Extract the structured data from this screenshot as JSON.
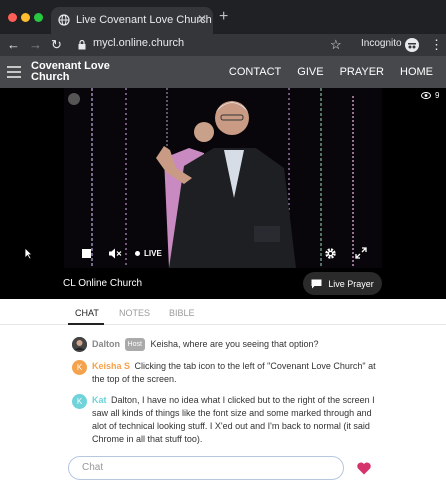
{
  "browser": {
    "tab_title": "Live Covenant Love Church",
    "tab_close": "✕",
    "new_tab": "+",
    "url": "mycl.online.church",
    "incognito": "Incognito",
    "back": "←",
    "forward": "→",
    "reload": "↻",
    "star": "☆",
    "menu": "⋮"
  },
  "site": {
    "brand": "Covenant Love Church",
    "nav": [
      "CONTACT",
      "GIVE",
      "PRAYER",
      "HOME"
    ]
  },
  "video": {
    "live_label": "LIVE",
    "viewer_count": "9",
    "channel": "CL Online Church",
    "live_prayer_button": "Live Prayer"
  },
  "chat": {
    "tabs": [
      "CHAT",
      "NOTES",
      "BIBLE"
    ],
    "active_tab": "CHAT",
    "messages": [
      {
        "name": "Dalton",
        "badge": "Host",
        "text": "Keisha, where are you seeing that option?",
        "avatar_color": "#3a3a3a"
      },
      {
        "name": "Keisha S",
        "initial": "K",
        "text": "Clicking the tab icon to the left of \"Covenant Love Church\" at the top of the screen.",
        "avatar_color": "#f4a24b"
      },
      {
        "name": "Kat",
        "initial": "K",
        "text": "Dalton, I have no idea what I clicked but to the right of the screen I saw all kinds of things like the font size and some marked through and alot of technical looking stuff. I X'ed out and I'm back to normal (it said Chrome in all that stuff too).",
        "avatar_color": "#6fd3d9"
      }
    ],
    "input_placeholder": "Chat",
    "heart_color": "#d6336c"
  }
}
